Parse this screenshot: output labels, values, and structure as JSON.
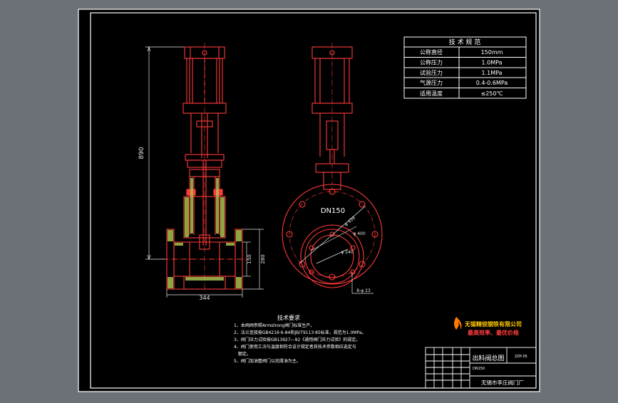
{
  "spec_table": {
    "title": "技 术 规 范",
    "rows": [
      {
        "label": "公称直径",
        "value": "150mm"
      },
      {
        "label": "公称压力",
        "value": "1.0MPa"
      },
      {
        "label": "试验压力",
        "value": "1.1MPa"
      },
      {
        "label": "气源压力",
        "value": "0.4-0.6MPa"
      },
      {
        "label": "适用温度",
        "value": "≤250℃"
      }
    ]
  },
  "dimensions": {
    "overall_height": "890",
    "face_width": "344",
    "bore_a": "150",
    "bore_b": "280",
    "nominal_label": "DN150",
    "dia_outer": "φ 438",
    "dia_pcd": "φ 400",
    "dia_inner": "φ 240",
    "bolt_holes": "8-φ 23"
  },
  "tech_requirements": {
    "title": "技术要求",
    "items": [
      "1、本阀阀参照Armstrong阀门标准生产。",
      "2、法兰连接按GB4216·6-84和JB/T9113·85标准，规范为1.0MPa。",
      "3、阀门压力试验按GB13927—92《通用阀门压力试验》的规定。",
      "4、阀门使用工况与温度相符合设计规定者其技术参数相应选定与",
      "额定。",
      "5、阀门加油整阀门以润滑油为主。"
    ]
  },
  "brand": {
    "company": "无锡精锐钢铁有限公司",
    "slogan": "最高效率、最优价格"
  },
  "title_block": {
    "drawing_name": "出料阀总图",
    "drawing_code": "DN150",
    "drawing_no": "ZDY-05",
    "manufacturer": "无锡市李庄阀门厂"
  },
  "colors": {
    "outside": "#6c7077",
    "sheet": "#000000",
    "frame": "#ffffff",
    "drawing": "#ff3a3a",
    "hatch": "#a8c04c",
    "dimension": "#e6e6e6",
    "text": "#ffffff",
    "brand_text": "#ffc800",
    "slogan_text": "#ff3d3d"
  }
}
